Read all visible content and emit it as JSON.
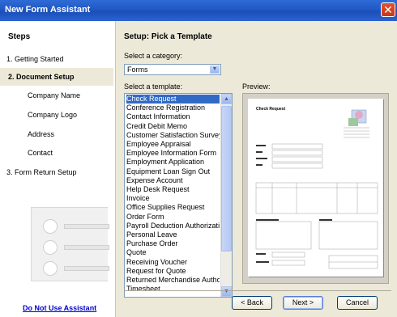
{
  "window": {
    "title": "New Form Assistant",
    "close_glyph": "✕"
  },
  "sidebar": {
    "heading": "Steps",
    "steps": [
      {
        "label": "1. Getting Started"
      },
      {
        "label": "2. Document Setup"
      },
      {
        "label": "Company Name"
      },
      {
        "label": "Company Logo"
      },
      {
        "label": "Address"
      },
      {
        "label": "Contact"
      },
      {
        "label": "3. Form Return Setup"
      }
    ],
    "no_assistant_link": "Do Not Use Assistant"
  },
  "main": {
    "heading": "Setup: Pick a Template",
    "category_label": "Select a category:",
    "category_value": "Forms",
    "template_label": "Select a template:",
    "preview_label": "Preview:",
    "templates": [
      "Check Request",
      "Conference Registration",
      "Contact Information",
      "Credit Debit Memo",
      "Customer Satisfaction Survey",
      "Employee Appraisal",
      "Employee Information Form",
      "Employment Application",
      "Equipment Loan Sign Out",
      "Expense Account",
      "Help Desk Request",
      "Invoice",
      "Office Supplies Request",
      "Order Form",
      "Payroll Deduction Authorization",
      "Personal Leave",
      "Purchase Order",
      "Quote",
      "Receiving Voucher",
      "Request for Quote",
      "Returned Merchandise Authorization",
      "Timesheet"
    ],
    "selected_template_index": 0,
    "preview_doc_title": "Check Request"
  },
  "buttons": {
    "back": "< Back",
    "next": "Next >",
    "cancel": "Cancel"
  },
  "colors": {
    "titlebar": "#2158c4",
    "selection": "#316ac5",
    "panel": "#ece9d8",
    "link": "#0000cc"
  }
}
